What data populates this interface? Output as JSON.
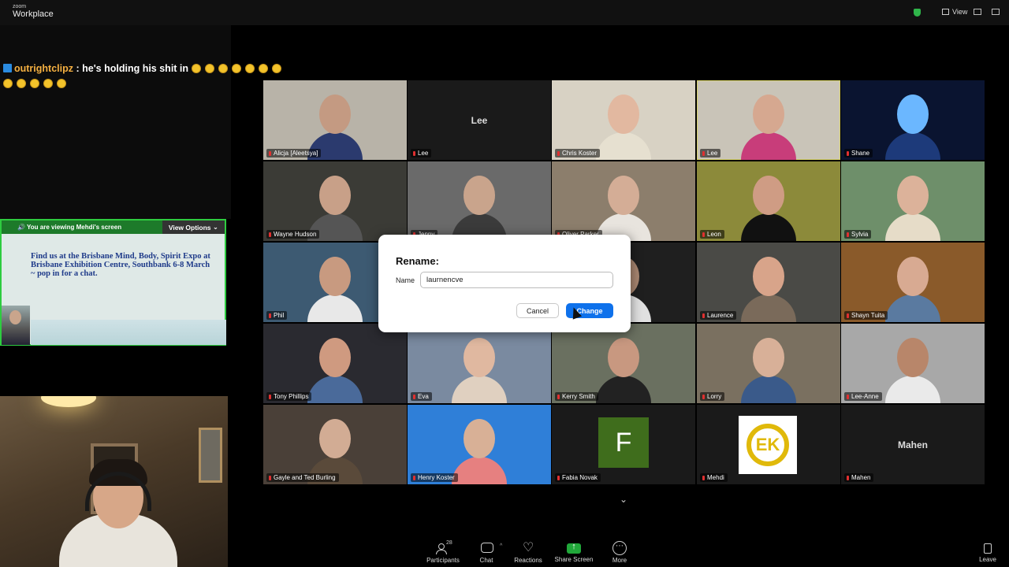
{
  "app": {
    "brand_small": "zoom",
    "brand_big": "Workplace",
    "view_label": "View"
  },
  "chat_overlay": {
    "username": "outrightclipz",
    "message": ": he's holding his shit in",
    "emoji_count_line1": 7,
    "emoji_count_line2": 5,
    "emoji_name": "rofl-emoji"
  },
  "share_panel": {
    "viewing_prefix": "You are viewing",
    "viewing_name": "Mehdi's screen",
    "view_options_label": "View Options",
    "content_text": "Find us at the Brisbane Mind,  Body, Spirit Expo at Brisbane Exhibition Centre, Southbank 6-8 March ~ pop in for a chat."
  },
  "gallery": {
    "tiles": [
      {
        "name": "Alicja [Aleetsya]",
        "type": "video",
        "bg": "#b8b3a8",
        "skin": "#c49a82",
        "shirt": "#2b3a6e"
      },
      {
        "name": "Lee",
        "type": "name",
        "big": "Lee",
        "bg": "#1a1a1a"
      },
      {
        "name": "Chris Koster",
        "type": "video",
        "bg": "#d8d2c4",
        "skin": "#e2b8a0",
        "shirt": "#e6e0d0"
      },
      {
        "name": "Lee",
        "type": "video",
        "bg": "#c9c4b8",
        "skin": "#d6a890",
        "shirt": "#c83d7a",
        "active": true
      },
      {
        "name": "Shane",
        "type": "video",
        "bg": "#0a1430",
        "skin": "#6bb7ff",
        "shirt": "#1d3a7a"
      },
      {
        "name": "Wayne Hudson",
        "type": "video",
        "bg": "#3b3b36",
        "skin": "#c8a088",
        "shirt": "#555"
      },
      {
        "name": "Jenny",
        "type": "video",
        "bg": "#6a6a6a",
        "skin": "#c9a48c",
        "shirt": "#3b3b3b"
      },
      {
        "name": "Oliver Parker",
        "type": "video",
        "bg": "#8c7e6c",
        "skin": "#d4ad96",
        "shirt": "#e8e4de"
      },
      {
        "name": "Leon",
        "type": "video",
        "bg": "#8c8a3a",
        "skin": "#cf9c84",
        "shirt": "#111"
      },
      {
        "name": "Sylvia",
        "type": "video",
        "bg": "#6e8f6a",
        "skin": "#dcb29a",
        "shirt": "#e6dcc8"
      },
      {
        "name": "Phil",
        "type": "video",
        "bg": "#3d5a72",
        "skin": "#c89a80",
        "shirt": "#e8e8e8"
      },
      {
        "name": "",
        "type": "video",
        "bg": "#2a2a2a",
        "skin": "#b08a70",
        "shirt": "#333"
      },
      {
        "name": "",
        "type": "video",
        "bg": "#1f1f1f",
        "skin": "#a88670",
        "shirt": "#e0e0e0"
      },
      {
        "name": "Laurence",
        "type": "video",
        "bg": "#4a4a46",
        "skin": "#d8a48a",
        "shirt": "#7a6a5a"
      },
      {
        "name": "Shayn Tuita",
        "type": "video",
        "bg": "#8a5a2a",
        "skin": "#d8aa92",
        "shirt": "#5a7aa0"
      },
      {
        "name": "Tony Phillips",
        "type": "video",
        "bg": "#2a2a30",
        "skin": "#cf9a80",
        "shirt": "#4a6a9a"
      },
      {
        "name": "Eva",
        "type": "video",
        "bg": "#7a8aa0",
        "skin": "#e0b8a0",
        "shirt": "#e0d0c0"
      },
      {
        "name": "Kerry Smith",
        "type": "video",
        "bg": "#6a7060",
        "skin": "#c89880",
        "shirt": "#222"
      },
      {
        "name": "Lorry",
        "type": "video",
        "bg": "#7a7060",
        "skin": "#d8b098",
        "shirt": "#3a5a8a"
      },
      {
        "name": "Lee-Anne",
        "type": "video",
        "bg": "#a8a8a8",
        "skin": "#b8866a",
        "shirt": "#eaeaea"
      },
      {
        "name": "Gayle and Ted Burling",
        "type": "video",
        "bg": "#4a4038",
        "skin": "#d2ac94",
        "shirt": "#5a4a3a"
      },
      {
        "name": "Henry Koster",
        "type": "video",
        "bg": "#2f7fd8",
        "skin": "#d8b096",
        "shirt": "#e68080"
      },
      {
        "name": "Fabia Novak",
        "type": "letter",
        "letter": "F",
        "bg": "#1a1a1a"
      },
      {
        "name": "Mehdi",
        "type": "logo",
        "logo_text": "EK",
        "bg": "#1a1a1a"
      },
      {
        "name": "Mahen",
        "type": "name",
        "big": "Mahen",
        "bg": "#1a1a1a"
      }
    ]
  },
  "dialog": {
    "title": "Rename:",
    "name_label": "Name",
    "input_value": "laurnencve",
    "cancel_label": "Cancel",
    "change_label": "Change"
  },
  "toolbar": {
    "participants_label": "Participants",
    "participants_count": "28",
    "chat_label": "Chat",
    "reactions_label": "Reactions",
    "share_label": "Share Screen",
    "more_label": "More",
    "leave_label": "Leave"
  },
  "colors": {
    "zoom_blue": "#0e71eb",
    "share_green": "#2ecc40",
    "active_speaker": "#d8d36c"
  }
}
